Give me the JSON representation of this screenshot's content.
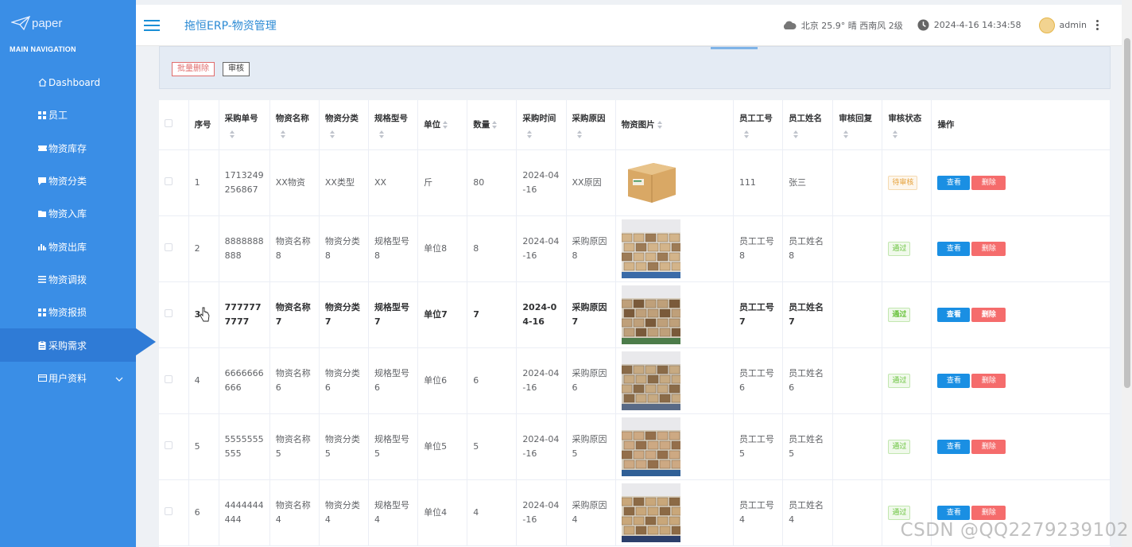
{
  "sidebar": {
    "logo_text": "paper",
    "caption": "MAIN NAVIGATION",
    "items": [
      {
        "label": "Dashboard",
        "icon": "home-icon"
      },
      {
        "label": "员工",
        "icon": "grid-icon"
      },
      {
        "label": "物资库存",
        "icon": "ticket-icon"
      },
      {
        "label": "物资分类",
        "icon": "comment-icon"
      },
      {
        "label": "物资入库",
        "icon": "folder-icon"
      },
      {
        "label": "物资出库",
        "icon": "bar-chart-icon"
      },
      {
        "label": "物资调拨",
        "icon": "list-icon"
      },
      {
        "label": "物资报损",
        "icon": "grid-icon"
      },
      {
        "label": "采购需求",
        "icon": "clipboard-icon",
        "active": true
      },
      {
        "label": "用户资料",
        "icon": "card-icon",
        "expandable": true
      }
    ]
  },
  "header": {
    "title": "拖恒ERP-物资管理",
    "weather": "北京 25.9° 晴 西南风 2级",
    "datetime": "2024-4-16 14:34:58",
    "user": "admin"
  },
  "actions": {
    "batch_delete": "批量删除",
    "audit": "审核"
  },
  "table": {
    "columns": [
      {
        "label": "",
        "sortable": false
      },
      {
        "label": "序号",
        "sortable": false
      },
      {
        "label": "采购单号",
        "sortable": true,
        "stack": true
      },
      {
        "label": "物资名称",
        "sortable": true,
        "stack": true
      },
      {
        "label": "物资分类",
        "sortable": true,
        "stack": true
      },
      {
        "label": "规格型号",
        "sortable": true,
        "stack": true
      },
      {
        "label": "单位",
        "sortable": true,
        "stack": false
      },
      {
        "label": "数量",
        "sortable": true,
        "stack": false
      },
      {
        "label": "采购时间",
        "sortable": true,
        "stack": true
      },
      {
        "label": "采购原因",
        "sortable": true,
        "stack": true
      },
      {
        "label": "物资图片",
        "sortable": true,
        "stack": false
      },
      {
        "label": "员工工号",
        "sortable": true,
        "stack": true
      },
      {
        "label": "员工姓名",
        "sortable": true,
        "stack": true
      },
      {
        "label": "审核回复",
        "sortable": true,
        "stack": true
      },
      {
        "label": "审核状态",
        "sortable": true,
        "stack": true
      },
      {
        "label": "操作",
        "sortable": false
      }
    ],
    "view_label": "查看",
    "delete_label": "删除",
    "rows": [
      {
        "idx": "1",
        "order_no": "1713249256867",
        "name": "XX物资",
        "category": "XX类型",
        "spec": "XX",
        "unit": "斤",
        "qty": "80",
        "date": "2024-04-16",
        "reason": "XX原因",
        "image": "box-image",
        "emp_no": "111",
        "emp_name": "张三",
        "reply": "",
        "status": "待审核",
        "status_type": "pend"
      },
      {
        "idx": "2",
        "order_no": "8888888888",
        "name": "物资名称8",
        "category": "物资分类8",
        "spec": "规格型号8",
        "unit": "单位8",
        "qty": "8",
        "date": "2024-04-16",
        "reason": "采购原因8",
        "image": "warehouse-image",
        "emp_no": "员工工号8",
        "emp_name": "员工姓名8",
        "reply": "",
        "status": "通过",
        "status_type": "pass"
      },
      {
        "idx": "3",
        "order_no": "7777777777",
        "name": "物资名称7",
        "category": "物资分类7",
        "spec": "规格型号7",
        "unit": "单位7",
        "qty": "7",
        "date": "2024-04-16",
        "reason": "采购原因7",
        "image": "warehouse-image",
        "emp_no": "员工工号7",
        "emp_name": "员工姓名7",
        "reply": "",
        "status": "通过",
        "status_type": "pass",
        "bold": true
      },
      {
        "idx": "4",
        "order_no": "6666666666",
        "name": "物资名称6",
        "category": "物资分类6",
        "spec": "规格型号6",
        "unit": "单位6",
        "qty": "6",
        "date": "2024-04-16",
        "reason": "采购原因6",
        "image": "warehouse-image",
        "emp_no": "员工工号6",
        "emp_name": "员工姓名6",
        "reply": "",
        "status": "通过",
        "status_type": "pass"
      },
      {
        "idx": "5",
        "order_no": "5555555555",
        "name": "物资名称5",
        "category": "物资分类5",
        "spec": "规格型号5",
        "unit": "单位5",
        "qty": "5",
        "date": "2024-04-16",
        "reason": "采购原因5",
        "image": "warehouse-image",
        "emp_no": "员工工号5",
        "emp_name": "员工姓名5",
        "reply": "",
        "status": "通过",
        "status_type": "pass"
      },
      {
        "idx": "6",
        "order_no": "4444444444",
        "name": "物资名称4",
        "category": "物资分类4",
        "spec": "规格型号4",
        "unit": "单位4",
        "qty": "4",
        "date": "2024-04-16",
        "reason": "采购原因4",
        "image": "warehouse-image",
        "emp_no": "员工工号4",
        "emp_name": "员工姓名4",
        "reply": "",
        "status": "通过",
        "status_type": "pass"
      }
    ]
  },
  "watermark": "CSDN @QQ2279239102",
  "colors": {
    "sidebar": "#3a8ee6",
    "primary": "#1a8fe3",
    "danger": "#f56c6c",
    "title": "#2b8ad4"
  }
}
